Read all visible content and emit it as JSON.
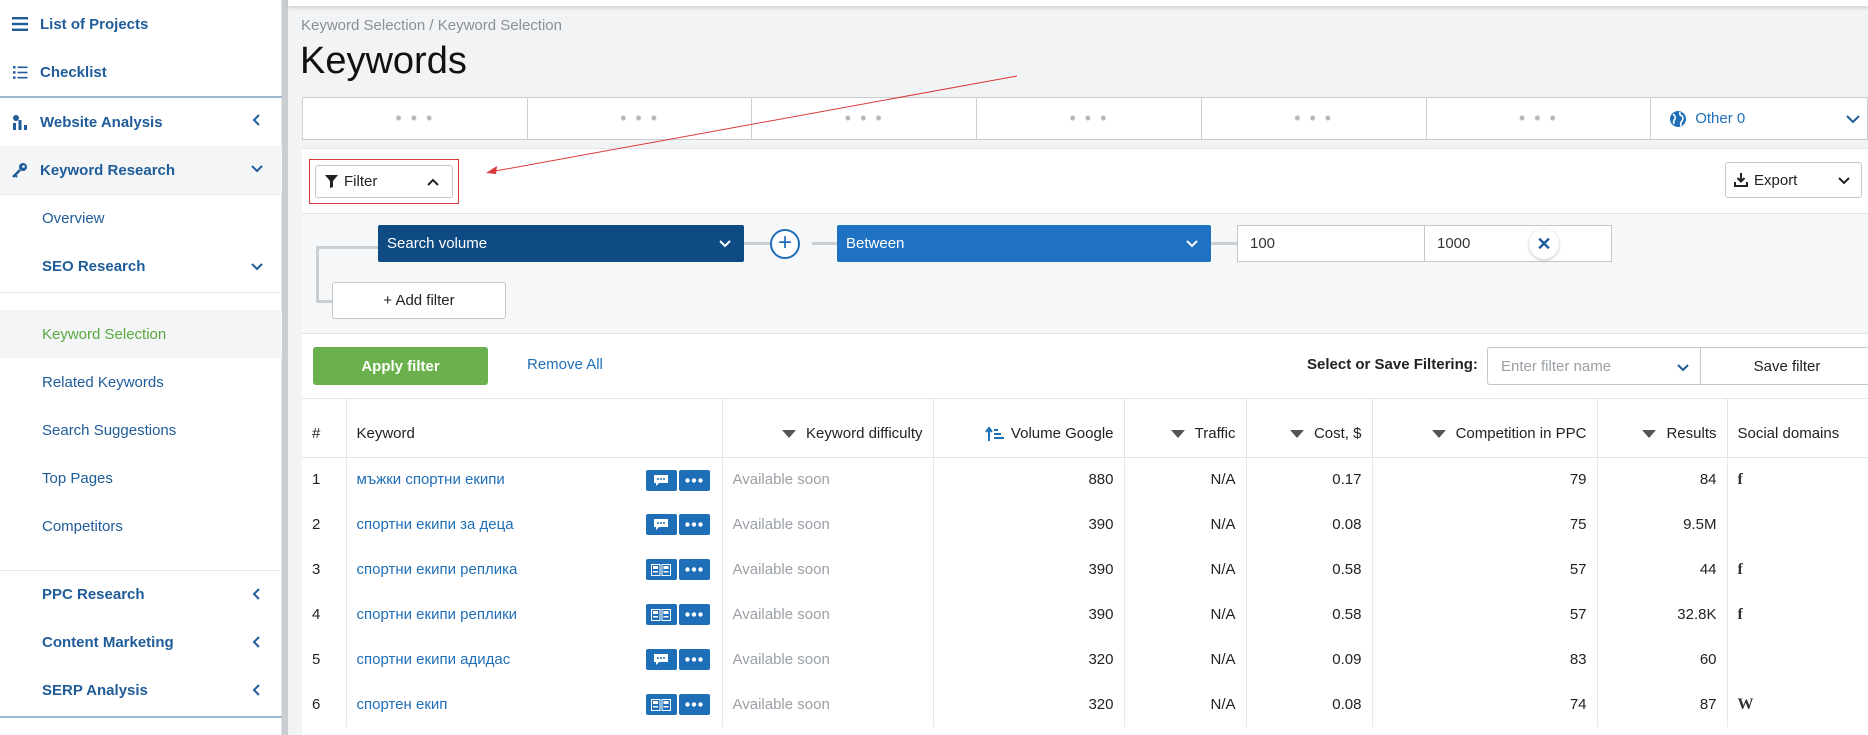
{
  "sidebar": {
    "list_of_projects": "List of Projects",
    "checklist": "Checklist",
    "website_analysis": "Website Analysis",
    "keyword_research": "Keyword Research",
    "overview": "Overview",
    "seo_research": "SEO Research",
    "keyword_selection": "Keyword Selection",
    "related_keywords": "Related Keywords",
    "search_suggestions": "Search Suggestions",
    "top_pages": "Top Pages",
    "competitors": "Competitors",
    "ppc_research": "PPC Research",
    "content_marketing": "Content Marketing",
    "serp_analysis": "SERP Analysis"
  },
  "breadcrumb": "Keyword Selection / Keyword Selection",
  "page_title": "Keywords",
  "tabs": {
    "loading": "• • •",
    "other": "Other 0"
  },
  "filter": {
    "button_label": "Filter",
    "export_label": "Export",
    "field": "Search volume",
    "operator": "Between",
    "min": "100",
    "max": "1000",
    "add_filter": "+ Add filter",
    "apply": "Apply filter",
    "remove_all": "Remove All",
    "save_label": "Select or Save Filtering:",
    "filter_name_placeholder": "Enter filter name",
    "save_filter": "Save filter"
  },
  "table": {
    "columns": [
      "#",
      "Keyword",
      "Keyword difficulty",
      "Volume Google",
      "Traffic",
      "Cost, $",
      "Competition in PPC",
      "Results",
      "Social domains"
    ],
    "rows": [
      {
        "n": "1",
        "keyword": "мъжки спортни екипи",
        "difficulty": "Available soon",
        "volume": "880",
        "traffic": "N/A",
        "cost": "0.17",
        "competition": "79",
        "results": "84",
        "social": "f"
      },
      {
        "n": "2",
        "keyword": "спортни екипи за деца",
        "difficulty": "Available soon",
        "volume": "390",
        "traffic": "N/A",
        "cost": "0.08",
        "competition": "75",
        "results": "9.5M",
        "social": ""
      },
      {
        "n": "3",
        "keyword": "спортни екипи реплика",
        "difficulty": "Available soon",
        "volume": "390",
        "traffic": "N/A",
        "cost": "0.58",
        "competition": "57",
        "results": "44",
        "social": "f"
      },
      {
        "n": "4",
        "keyword": "спортни екипи реплики",
        "difficulty": "Available soon",
        "volume": "390",
        "traffic": "N/A",
        "cost": "0.58",
        "competition": "57",
        "results": "32.8K",
        "social": "f"
      },
      {
        "n": "5",
        "keyword": "спортни екипи адидас",
        "difficulty": "Available soon",
        "volume": "320",
        "traffic": "N/A",
        "cost": "0.09",
        "competition": "83",
        "results": "60",
        "social": ""
      },
      {
        "n": "6",
        "keyword": "спортен екип",
        "difficulty": "Available soon",
        "volume": "320",
        "traffic": "N/A",
        "cost": "0.08",
        "competition": "74",
        "results": "87",
        "social": "W"
      }
    ]
  },
  "colors": {
    "link": "#1f6fb8",
    "dark_select": "#0e4a84",
    "blue_select": "#1f72c2",
    "apply_green": "#6ab04c",
    "active_green": "#5aa83f",
    "annotation_red": "#d93a3a"
  }
}
